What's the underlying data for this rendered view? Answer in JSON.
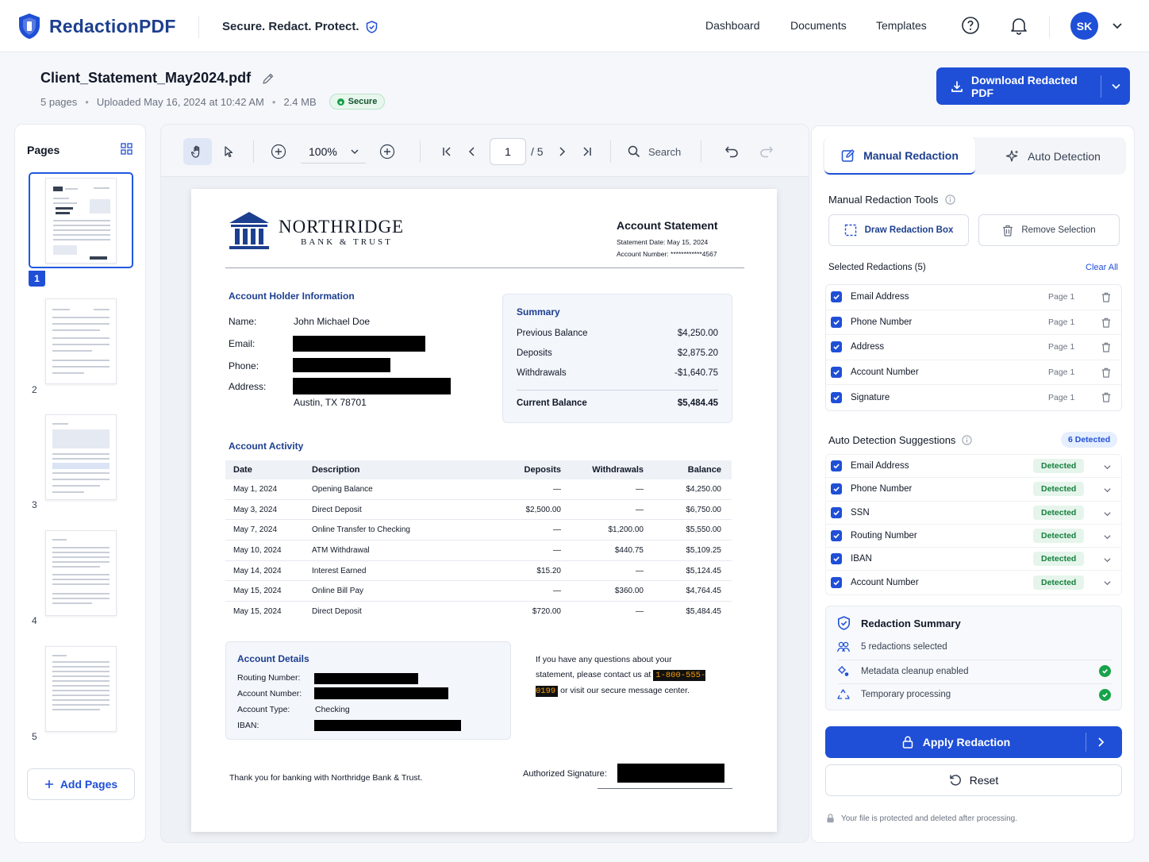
{
  "app": {
    "brand": "RedactionPDF",
    "tagline": "Secure. Redact. Protect."
  },
  "nav": {
    "links": [
      "Dashboard",
      "Documents",
      "Templates"
    ],
    "avatar_initials": "SK"
  },
  "file": {
    "name": "Client_Statement_May2024.pdf",
    "pages": "5 pages",
    "uploaded": "Uploaded May 16, 2024 at 10:42 AM",
    "size": "2.4 MB",
    "badge": "Secure",
    "download_label": "Download Redacted PDF"
  },
  "pages_panel": {
    "title": "Pages",
    "thumb_numbers": [
      "1",
      "2",
      "3",
      "4",
      "5"
    ],
    "add_label": "Add Pages"
  },
  "toolbar": {
    "zoom": "100%",
    "current_page": "1",
    "total_pages": "/ 5",
    "search_label": "Search"
  },
  "doc": {
    "bank_name": "NORTHRIDGE",
    "bank_sub": "BANK & TRUST",
    "stmt_title": "Account Statement",
    "stmt_date": "Statement Date: May 15, 2024",
    "stmt_account": "Account Number: ************4567",
    "holder_title": "Account Holder Information",
    "holder": {
      "name_label": "Name:",
      "name_value": "John Michael Doe",
      "email_label": "Email:",
      "phone_label": "Phone:",
      "address_label": "Address:",
      "address_line2": "Austin, TX 78701"
    },
    "summary": {
      "title": "Summary",
      "rows": [
        {
          "label": "Previous Balance",
          "value": "$4,250.00"
        },
        {
          "label": "Deposits",
          "value": "$2,875.20"
        },
        {
          "label": "Withdrawals",
          "value": "-$1,640.75"
        }
      ],
      "current_label": "Current Balance",
      "current_value": "$5,484.45"
    },
    "activity_title": "Account Activity",
    "activity_headers": [
      "Date",
      "Description",
      "Deposits",
      "Withdrawals",
      "Balance"
    ],
    "activity_rows": [
      [
        "May 1, 2024",
        "Opening Balance",
        "—",
        "—",
        "$4,250.00"
      ],
      [
        "May 3, 2024",
        "Direct Deposit",
        "$2,500.00",
        "—",
        "$6,750.00"
      ],
      [
        "May 7, 2024",
        "Online Transfer to Checking",
        "—",
        "$1,200.00",
        "$5,550.00"
      ],
      [
        "May 10, 2024",
        "ATM Withdrawal",
        "—",
        "$440.75",
        "$5,109.25"
      ],
      [
        "May 14, 2024",
        "Interest Earned",
        "$15.20",
        "—",
        "$5,124.45"
      ],
      [
        "May 15, 2024",
        "Online Bill Pay",
        "—",
        "$360.00",
        "$4,764.45"
      ],
      [
        "May 15, 2024",
        "Direct Deposit",
        "$720.00",
        "—",
        "$5,484.45"
      ]
    ],
    "details": {
      "title": "Account Details",
      "routing_label": "Routing Number:",
      "account_label": "Account Number:",
      "type_label": "Account Type:",
      "type_value": "Checking",
      "iban_label": "IBAN:"
    },
    "contact_pre": "If you have any questions about your statement, please contact us at",
    "contact_phone": "1-800-555-0199",
    "contact_post": "or visit our secure message center.",
    "thanks": "Thank you for banking with Northridge Bank & Trust.",
    "signature_label": "Authorized Signature:"
  },
  "right_panel": {
    "tab_manual": "Manual Redaction",
    "tab_auto": "Auto Detection",
    "tools_title": "Manual Redaction Tools",
    "draw_box": "Draw Redaction Box",
    "remove_selection": "Remove Selection",
    "selected_title": "Selected Redactions (5)",
    "clear_all": "Clear All",
    "selected": [
      {
        "label": "Email Address",
        "page": "Page 1"
      },
      {
        "label": "Phone Number",
        "page": "Page 1"
      },
      {
        "label": "Address",
        "page": "Page 1"
      },
      {
        "label": "Account Number",
        "page": "Page 1"
      },
      {
        "label": "Signature",
        "page": "Page 1"
      }
    ],
    "auto_title": "Auto Detection Suggestions",
    "detected_count": "6 Detected",
    "suggestions": [
      {
        "label": "Email Address",
        "status": "Detected"
      },
      {
        "label": "Phone Number",
        "status": "Detected"
      },
      {
        "label": "SSN",
        "status": "Detected"
      },
      {
        "label": "Routing Number",
        "status": "Detected"
      },
      {
        "label": "IBAN",
        "status": "Detected"
      },
      {
        "label": "Account Number",
        "status": "Detected"
      }
    ],
    "summary_title": "Redaction Summary",
    "summary_rows": [
      "5 redactions selected",
      "Metadata cleanup enabled",
      "Temporary processing"
    ],
    "apply_label": "Apply Redaction",
    "reset_label": "Reset",
    "footnote": "Your file is protected and deleted after processing."
  },
  "colors": {
    "primary": "#1f4fd6",
    "brand_text": "#1d3f8f",
    "success": "#16a34a",
    "redaction": "#000000"
  }
}
